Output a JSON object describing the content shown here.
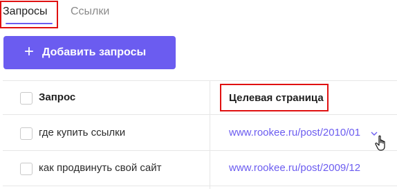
{
  "tabs": {
    "active": "Запросы",
    "inactive": "Ссылки"
  },
  "toolbar": {
    "add_icon": "+",
    "add_label": "Добавить запросы"
  },
  "table": {
    "columns": [
      "Запрос",
      "Целевая страница"
    ],
    "rows": [
      {
        "query": "где купить ссылки",
        "url": "www.rookee.ru/post/2010/01"
      },
      {
        "query": "как продвинуть свой сайт",
        "url": "www.rookee.ru/post/2009/12"
      }
    ]
  },
  "colors": {
    "accent": "#6b5cf0",
    "highlight": "#e01010"
  },
  "icons": [
    "plus-icon",
    "chevron-down-icon",
    "hand-pointer-cursor-icon"
  ]
}
